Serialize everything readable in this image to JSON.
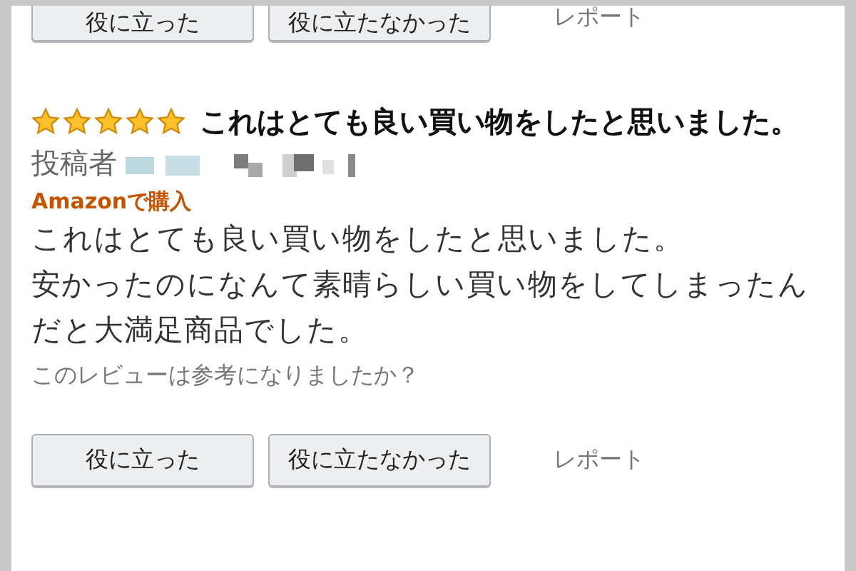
{
  "previous_review": {
    "buttons": [
      {
        "label": "役に立った",
        "kind": "button"
      },
      {
        "label": "役に立たなかった",
        "kind": "button"
      },
      {
        "label": "レポート",
        "kind": "link"
      }
    ]
  },
  "review": {
    "stars": 5,
    "title": "これはとても良い買い物をしたと思いました。",
    "author_label": "投稿者",
    "badge": "Amazonで購入",
    "body": [
      "これはとても良い買い物をしたと思いました。",
      "安かったのになんて素晴らしい買い物をしてしまったんだと大満足商品でした。"
    ],
    "question": "このレビューは参考になりましたか？",
    "buttons": [
      {
        "label": "役に立った",
        "kind": "button"
      },
      {
        "label": "役に立たなかった",
        "kind": "button"
      },
      {
        "label": "レポート",
        "kind": "link"
      }
    ]
  }
}
